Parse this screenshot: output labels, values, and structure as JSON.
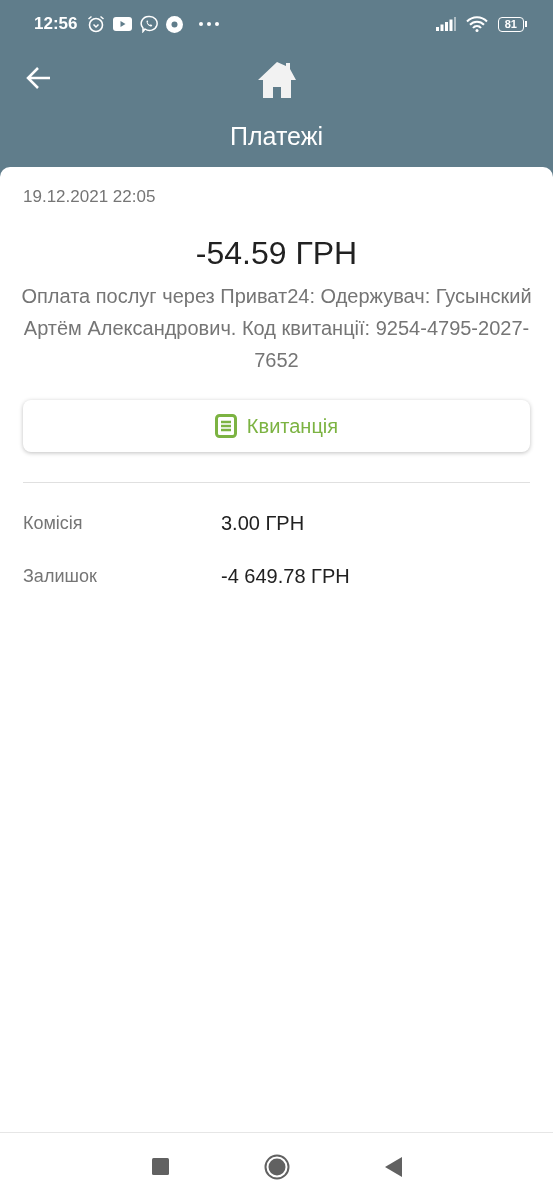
{
  "status_bar": {
    "time": "12:56",
    "battery": "81"
  },
  "header": {
    "title": "Платежі"
  },
  "payment": {
    "datetime": "19.12.2021 22:05",
    "amount": "-54.59 ГРН",
    "description": "Оплата послуг через Приват24: Одержувач: Гусынский Артём Александрович. Код квитанції: 9254-4795-2027-7652",
    "receipt_button": "Квитанція"
  },
  "details": [
    {
      "label": "Комісія",
      "value": "3.00 ГРН"
    },
    {
      "label": "Залишок",
      "value": "-4 649.78 ГРН"
    }
  ]
}
